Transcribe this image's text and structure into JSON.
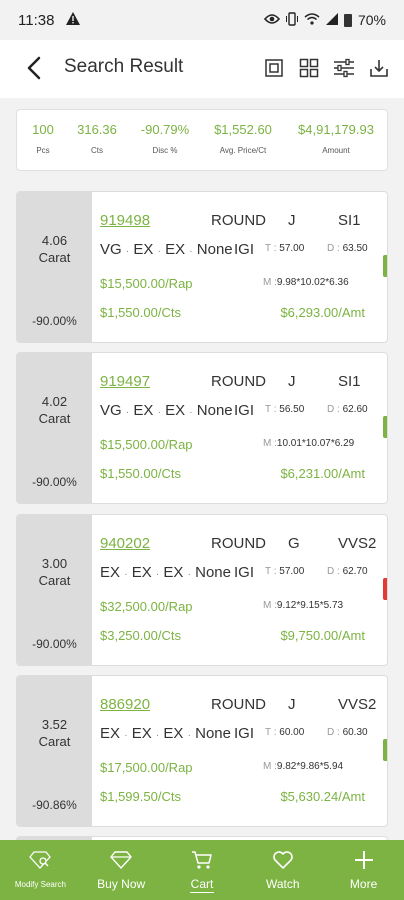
{
  "status": {
    "time": "11:38",
    "battery": "70%"
  },
  "header": {
    "title": "Search Result"
  },
  "summary": [
    {
      "value": "100",
      "label": "Pcs"
    },
    {
      "value": "316.36",
      "label": "Cts"
    },
    {
      "value": "-90.79%",
      "label": "Disc %"
    },
    {
      "value": "$1,552.60",
      "label": "Avg. Price/Ct"
    },
    {
      "value": "$4,91,179.93",
      "label": "Amount"
    }
  ],
  "results": [
    {
      "carat": "4.06",
      "carat_label": "Carat",
      "discount": "-90.00%",
      "stock_no": "919498",
      "shape": "ROUND",
      "color": "J",
      "clarity": "SI1",
      "cut": "VG",
      "polish": "EX",
      "symmetry": "EX",
      "fluorescence": "None",
      "lab": "IGI",
      "table_label": "T :",
      "table": "57.00",
      "depth_label": "D :",
      "depth": "63.50",
      "measurement_label": "M :",
      "measurement": "9.98*10.02*6.36",
      "rap": "$15,500.00/Rap",
      "price_per_ct": "$1,550.00/Cts",
      "amount": "$6,293.00/Amt",
      "marker_color": "#7cb342"
    },
    {
      "carat": "4.02",
      "carat_label": "Carat",
      "discount": "-90.00%",
      "stock_no": "919497",
      "shape": "ROUND",
      "color": "J",
      "clarity": "SI1",
      "cut": "VG",
      "polish": "EX",
      "symmetry": "EX",
      "fluorescence": "None",
      "lab": "IGI",
      "table_label": "T :",
      "table": "56.50",
      "depth_label": "D :",
      "depth": "62.60",
      "measurement_label": "M :",
      "measurement": "10.01*10.07*6.29",
      "rap": "$15,500.00/Rap",
      "price_per_ct": "$1,550.00/Cts",
      "amount": "$6,231.00/Amt",
      "marker_color": "#7cb342"
    },
    {
      "carat": "3.00",
      "carat_label": "Carat",
      "discount": "-90.00%",
      "stock_no": "940202",
      "shape": "ROUND",
      "color": "G",
      "clarity": "VVS2",
      "cut": "EX",
      "polish": "EX",
      "symmetry": "EX",
      "fluorescence": "None",
      "lab": "IGI",
      "table_label": "T :",
      "table": "57.00",
      "depth_label": "D :",
      "depth": "62.70",
      "measurement_label": "M :",
      "measurement": "9.12*9.15*5.73",
      "rap": "$32,500.00/Rap",
      "price_per_ct": "$3,250.00/Cts",
      "amount": "$9,750.00/Amt",
      "marker_color": "#e53935"
    },
    {
      "carat": "3.52",
      "carat_label": "Carat",
      "discount": "-90.86%",
      "stock_no": "886920",
      "shape": "ROUND",
      "color": "J",
      "clarity": "VVS2",
      "cut": "EX",
      "polish": "EX",
      "symmetry": "EX",
      "fluorescence": "None",
      "lab": "IGI",
      "table_label": "T :",
      "table": "60.00",
      "depth_label": "D :",
      "depth": "60.30",
      "measurement_label": "M :",
      "measurement": "9.82*9.86*5.94",
      "rap": "$17,500.00/Rap",
      "price_per_ct": "$1,599.50/Cts",
      "amount": "$5,630.24/Amt",
      "marker_color": "#7cb342"
    }
  ],
  "bottom_nav": [
    {
      "label": "Modify Search",
      "icon": "modify-search-icon"
    },
    {
      "label": "Buy Now",
      "icon": "diamond-icon"
    },
    {
      "label": "Cart",
      "icon": "cart-icon",
      "active": true
    },
    {
      "label": "Watch",
      "icon": "heart-icon"
    },
    {
      "label": "More",
      "icon": "plus-icon"
    }
  ],
  "colors": {
    "accent": "#7cb342",
    "alert": "#e53935"
  }
}
